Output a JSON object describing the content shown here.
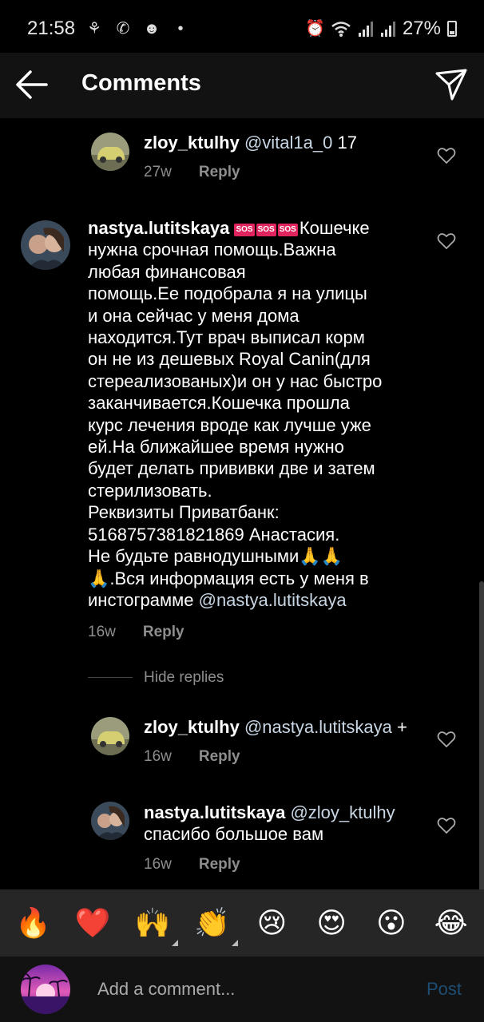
{
  "status": {
    "time": "21:58",
    "battery": "27%"
  },
  "header": {
    "title": "Comments"
  },
  "comments": [
    {
      "username": "zloy_ktulhy",
      "mention": "@vital1a_0",
      "text": " 17",
      "age": "27w",
      "reply": "Reply"
    },
    {
      "username": "nastya.lutitskaya",
      "sos": "SOS",
      "line1": "Кошечке",
      "body": "нужна срочная помощь.Важна\nлюбая финансовая\nпомощь.Ее подобрала я на улицы\nи она сейчас у меня дома\nнаходится.Тут врач выписал корм\nон не из дешевых Royal Canin(для\nстереализованых)и он у нас быстро\nзаканчивается.Кошечка прошла\nкурс лечения вроде как лучше уже\nей.На ближайшее время нужно\nбудет делать прививки две и затем\nстерилизовать.\nРеквизиты Приватбанк:\n5168757381821869 Анастасия.\nНе будьте равнодушными🙏🙏\n🙏.Вся информация есть у меня в\nинстограмме ",
      "mention": "@nastya.lutitskaya",
      "age": "16w",
      "reply": "Reply"
    },
    {
      "username": "zloy_ktulhy",
      "mention": "@nastya.lutitskaya",
      "text": " +",
      "age": "16w",
      "reply": "Reply"
    },
    {
      "username": "nastya.lutitskaya",
      "mention": "@zloy_ktulhy",
      "text": "спасибо большое вам",
      "age": "16w",
      "reply": "Reply"
    }
  ],
  "hide_replies": "Hide replies",
  "emoji_bar": {
    "items": [
      "🔥",
      "❤️",
      "🙌",
      "👏",
      "😢",
      "😍",
      "😮",
      "😂"
    ]
  },
  "input": {
    "placeholder": "Add a comment...",
    "post_label": "Post"
  },
  "colors": {
    "background": "#000000",
    "header": "#121212",
    "emoji_bar": "#262626",
    "post_disabled": "#1e4d74",
    "mention": "#c9d6e4",
    "meta": "#8e8e8e"
  }
}
